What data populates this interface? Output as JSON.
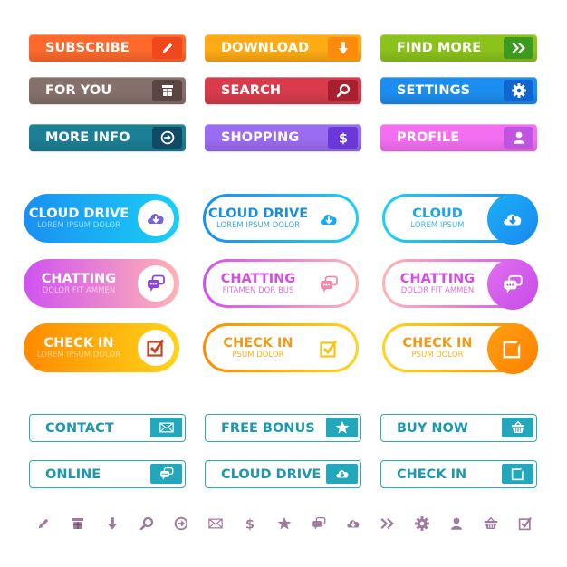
{
  "colors": {
    "icon_strip": "#a07a9c",
    "outline_teal": "#2aa9bc",
    "outline_text": "#1e98ae"
  },
  "rect_buttons": [
    {
      "label": "SUBSCRIBE",
      "icon": "pencil-icon",
      "bg": "#ff6a2c",
      "box": "#f0481c"
    },
    {
      "label": "DOWNLOAD",
      "icon": "arrow-down-icon",
      "bg": "#ffab14",
      "box": "#fd8a0a"
    },
    {
      "label": "FIND MORE",
      "icon": "double-chevron-right-icon",
      "bg": "#8cc31b",
      "box": "#3c9a22"
    },
    {
      "label": "FOR YOU",
      "icon": "gift-box-icon",
      "bg": "#86706b",
      "box": "#5a4542"
    },
    {
      "label": "SEARCH",
      "icon": "magnifier-icon",
      "bg": "#d83c4c",
      "box": "#a82030"
    },
    {
      "label": "SETTINGS",
      "icon": "gear-icon",
      "bg": "#1c8ef0",
      "box": "#0f66d0"
    },
    {
      "label": "MORE INFO",
      "icon": "circle-arrow-right-icon",
      "bg": "#1b7f96",
      "box": "#0f4a66"
    },
    {
      "label": "SHOPPING",
      "icon": "dollar-icon",
      "bg": "#9a6cf2",
      "box": "#6a38d8"
    },
    {
      "label": "PROFILE",
      "icon": "user-icon",
      "bg": "#f46ef2",
      "box": "#c054e0"
    }
  ],
  "pill_buttons": [
    {
      "title": "CLOUD DRIVE",
      "subtitle": "LOREM IPSUM DOLOR",
      "icon": "cloud-download-icon",
      "style": "filled"
    },
    {
      "title": "CLOUD DRIVE",
      "subtitle": "LOREM IPSUM DOLOR",
      "icon": "cloud-download-icon",
      "style": "outline"
    },
    {
      "title": "CLOUD",
      "subtitle": "LOREM IPSUM",
      "icon": "cloud-download-icon",
      "style": "outline-circle"
    },
    {
      "title": "CHATTING",
      "subtitle": "DOLOR FIT AMMEN",
      "icon": "chat-bubbles-icon",
      "style": "filled"
    },
    {
      "title": "CHATTING",
      "subtitle": "FITAMEN DOR BUS",
      "icon": "chat-bubbles-icon",
      "style": "outline"
    },
    {
      "title": "CHATTING",
      "subtitle": "DOLOR FIT AMMEN",
      "icon": "chat-bubbles-icon",
      "style": "outline-circle"
    },
    {
      "title": "CHECK IN",
      "subtitle": "LOREM IPSUM DOLOR",
      "icon": "checkbox-icon",
      "style": "filled"
    },
    {
      "title": "CHECK IN",
      "subtitle": "PSUM DOLOR",
      "icon": "checkbox-icon",
      "style": "outline"
    },
    {
      "title": "CHECK IN",
      "subtitle": "PSUM DOLOR",
      "icon": "checkbox-icon",
      "style": "outline-circle"
    }
  ],
  "outline_buttons": [
    {
      "label": "CONTACT",
      "icon": "envelope-icon"
    },
    {
      "label": "FREE BONUS",
      "icon": "star-icon"
    },
    {
      "label": "BUY NOW",
      "icon": "basket-icon"
    },
    {
      "label": "ONLINE",
      "icon": "chat-bubbles-icon"
    },
    {
      "label": "CLOUD DRIVE",
      "icon": "cloud-download-icon"
    },
    {
      "label": "CHECK IN",
      "icon": "checkbox-icon"
    }
  ],
  "icon_strip": [
    "pencil-icon",
    "gift-box-icon",
    "arrow-down-icon",
    "magnifier-icon",
    "circle-arrow-right-icon",
    "envelope-icon",
    "dollar-icon",
    "star-icon",
    "chat-bubbles-icon",
    "cloud-download-icon",
    "double-chevron-right-icon",
    "gear-icon",
    "user-icon",
    "basket-icon",
    "checkbox-icon"
  ]
}
